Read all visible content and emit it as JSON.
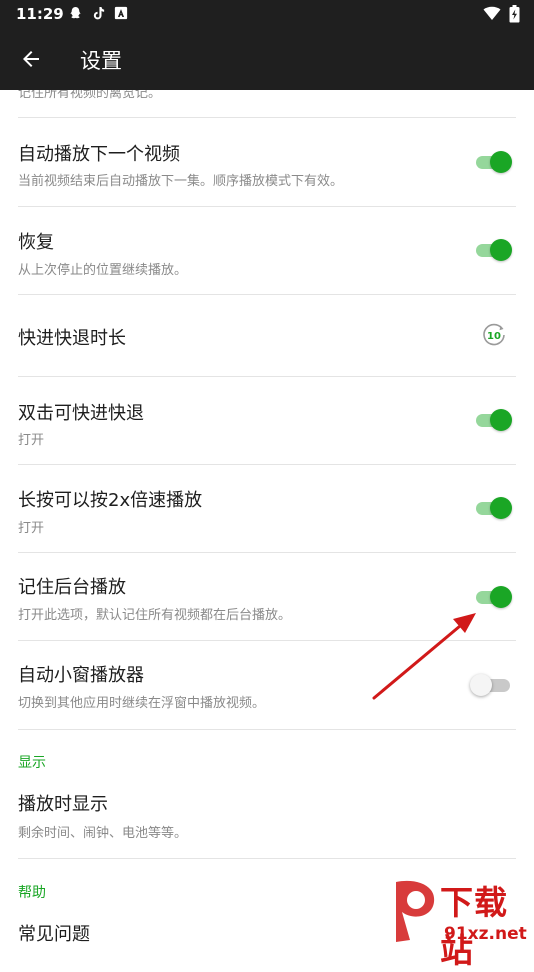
{
  "status_bar": {
    "time": "11:29",
    "left_icons": [
      "qq-icon",
      "tiktok-icon",
      "app-icon"
    ],
    "right_icons": [
      "wifi-icon",
      "battery-icon"
    ]
  },
  "toolbar": {
    "title": "设置"
  },
  "cut_off_text": "记住所有视频的离览记。",
  "settings": [
    {
      "title": "自动播放下一个视频",
      "subtitle": "当前视频结束后自动播放下一集。顺序播放模式下有效。",
      "control": "toggle",
      "enabled": true
    },
    {
      "title": "恢复",
      "subtitle": "从上次停止的位置继续播放。",
      "control": "toggle",
      "enabled": true
    },
    {
      "title": "快进快退时长",
      "subtitle": "",
      "control": "seek-icon",
      "icon_value": "10"
    },
    {
      "title": "双击可快进快退",
      "subtitle": "打开",
      "control": "toggle",
      "enabled": true
    },
    {
      "title": "长按可以按2x倍速播放",
      "subtitle": "打开",
      "control": "toggle",
      "enabled": true
    },
    {
      "title": "记住后台播放",
      "subtitle": "打开此选项，默认记住所有视频都在后台播放。",
      "control": "toggle",
      "enabled": true
    },
    {
      "title": "自动小窗播放器",
      "subtitle": "切换到其他应用时继续在浮窗中播放视频。",
      "control": "toggle",
      "enabled": false
    }
  ],
  "sections": {
    "display": {
      "header": "显示",
      "items": [
        {
          "title": "播放时显示",
          "subtitle": "剩余时间、闹钟、电池等等。"
        }
      ]
    },
    "help": {
      "header": "帮助",
      "items": [
        {
          "title": "常见问题"
        }
      ]
    }
  },
  "watermark": {
    "text_top": "下载站",
    "text_bottom": "91xz.net"
  },
  "colors": {
    "accent": "#1aa625",
    "toggle_track_on": "#95d79b",
    "bar_background": "#1f1f1f",
    "annotation_arrow": "#d11919"
  }
}
